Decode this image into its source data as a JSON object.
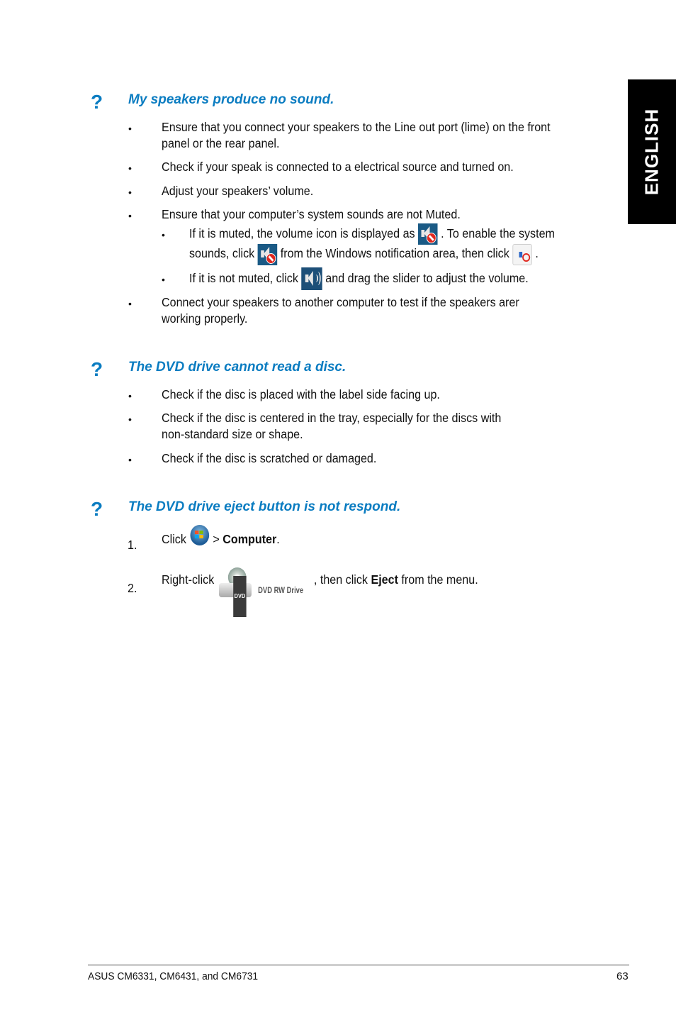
{
  "side_tab": {
    "label": "ENGLISH"
  },
  "sections": [
    {
      "icon": "?",
      "title": "My speakers produce no sound.",
      "bullets": [
        {
          "line1": "Ensure that you connect your speakers to the Line out port (lime) on the front",
          "line2": "panel or the rear panel."
        },
        {
          "line1": "Check if your speak is connected to a electrical source and turned on."
        },
        {
          "line1": "Adjust your speakers’ volume."
        },
        {
          "line1": "Ensure that your computer’s system sounds are not Muted."
        },
        {
          "line1": "Connect your speakers to another computer to test if the speakers arer",
          "line2": "working properly."
        }
      ],
      "sub_bullets": {
        "muted": {
          "part1": "If it is muted, the volume icon is displayed as",
          "part2": ". To enable the system",
          "part3": "sounds, click",
          "part4": "from the Windows notification area, then click",
          "part5": "."
        },
        "not_muted": {
          "part1": "If it is not muted, click",
          "part2": "and drag the slider to adjust the volume."
        }
      }
    },
    {
      "icon": "?",
      "title": "The DVD drive cannot read a disc.",
      "bullets": [
        {
          "line1": "Check if the disc is placed with the label side facing up."
        },
        {
          "line1": "Check if the disc is centered in the tray, especially for the discs with",
          "line2": "non-standard size or shape."
        },
        {
          "line1": "Check if the disc is scratched or damaged."
        }
      ]
    },
    {
      "icon": "?",
      "title": "The DVD drive eject button is not respond.",
      "steps": [
        {
          "num": "1.",
          "pre": "Click",
          "mid": " > ",
          "bold": "Computer",
          "post": "."
        },
        {
          "num": "2.",
          "pre": "Right-click",
          "mid": ", then click ",
          "bold": "Eject",
          "post": " from the menu."
        }
      ],
      "dvd_label": "DVD",
      "dvd_name": "DVD RW Drive"
    }
  ],
  "bullet_char": "•",
  "footer": {
    "left": "ASUS CM6331, CM6431, and CM6731",
    "page": "63"
  },
  "colors": {
    "heading": "#0a7cc1",
    "side_tab_bg": "#000000"
  }
}
